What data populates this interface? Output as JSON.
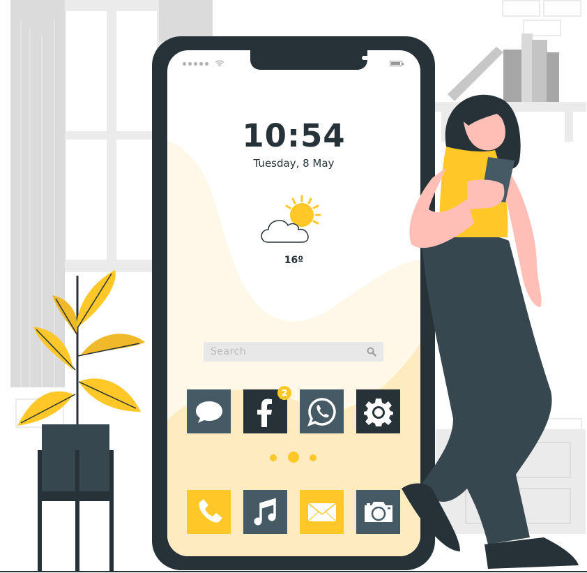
{
  "status_bar": {
    "signal_bars": 5,
    "wifi_icon": "wifi-icon",
    "battery_icon": "battery-icon",
    "battery_level": 0.8
  },
  "lock_screen": {
    "time": "10:54",
    "date": "Tuesday, 8 May",
    "weather": {
      "icon": "partly-cloudy-icon",
      "temperature": "16º"
    }
  },
  "search": {
    "placeholder": "Search",
    "icon": "search-icon"
  },
  "apps_row_1": [
    {
      "name": "Messages",
      "icon": "chat-bubble-icon"
    },
    {
      "name": "Facebook",
      "icon": "facebook-icon",
      "badge": "2"
    },
    {
      "name": "WhatsApp",
      "icon": "whatsapp-icon"
    },
    {
      "name": "Settings",
      "icon": "gear-icon"
    }
  ],
  "page_indicator": {
    "pages": 3,
    "current": 2
  },
  "apps_row_2": [
    {
      "name": "Phone",
      "icon": "phone-icon"
    },
    {
      "name": "Music",
      "icon": "music-note-icon"
    },
    {
      "name": "Mail",
      "icon": "envelope-icon"
    },
    {
      "name": "Camera",
      "icon": "camera-icon"
    }
  ],
  "colors": {
    "accent": "#ffc727",
    "phone_body": "#263238",
    "app_slate": "#455a64",
    "screen_wave_light": "#fef8e8",
    "screen_wave": "#feecc0",
    "skin": "#ffbfb6",
    "pants": "#37474f"
  }
}
